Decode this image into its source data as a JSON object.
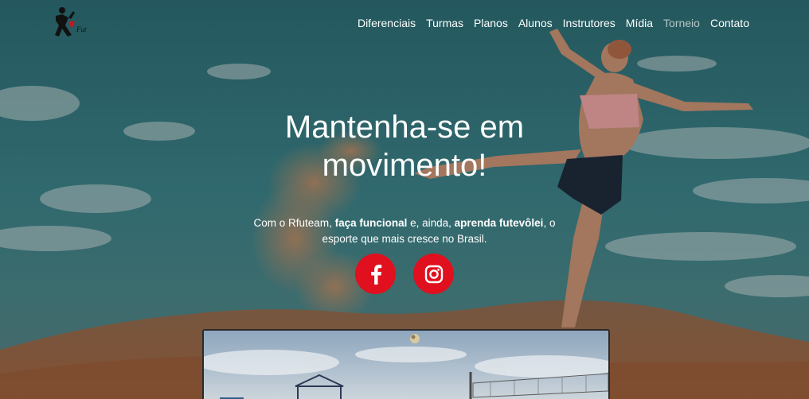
{
  "nav": {
    "logo_alt": "Rfuteam",
    "items": [
      {
        "label": "Diferenciais"
      },
      {
        "label": "Turmas"
      },
      {
        "label": "Planos"
      },
      {
        "label": "Alunos"
      },
      {
        "label": "Instrutores"
      },
      {
        "label": "Mídia"
      },
      {
        "label": "Torneio"
      },
      {
        "label": "Contato"
      }
    ]
  },
  "hero": {
    "headline_line1": "Mantenha-se em",
    "headline_line2": "movimento!",
    "tagline": {
      "p1": "Com o Rfuteam, ",
      "b1": "faça funcional",
      "p2": " e, ainda, ",
      "b2": "aprenda futevôlei",
      "p3": ", o",
      "p4": "esporte que mais cresce no Brasil."
    }
  },
  "social": {
    "facebook_icon": "facebook-icon",
    "instagram_icon": "instagram-icon"
  },
  "colors": {
    "accent": "#e0101e",
    "text": "#ffffff",
    "nav_muted": "#b7c7c8"
  }
}
